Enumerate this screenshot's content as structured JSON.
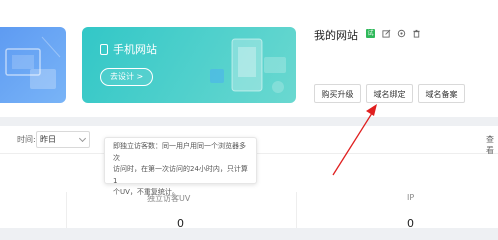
{
  "mobile_site": {
    "title": "手机网站",
    "design_button": "去设计 >"
  },
  "site": {
    "name": "我的网站",
    "badge": "试"
  },
  "actions": {
    "upgrade": "购买升级",
    "bind_domain": "域名绑定",
    "domain_filing": "域名备案"
  },
  "toolbar": {
    "time_label": "时间:",
    "time_value": "昨日",
    "right_text": "查看"
  },
  "tooltip": {
    "lines": [
      "即独立访客数：同一用户用同一个浏览器多次",
      "访问时，在第一次访问的24小时内，只计算1",
      "个UV，不重复统计。"
    ]
  },
  "stats": [
    {
      "label": "独立访客UV",
      "value": "0"
    },
    {
      "label": "IP",
      "value": "0"
    }
  ],
  "colors": {
    "accent_green": "#2fb85a",
    "mobile_card": "#32c7c7",
    "annotation_arrow": "#e02020"
  },
  "icons": [
    "phone-icon",
    "edit-icon",
    "settings-icon",
    "trash-icon",
    "chevron-down-icon"
  ]
}
